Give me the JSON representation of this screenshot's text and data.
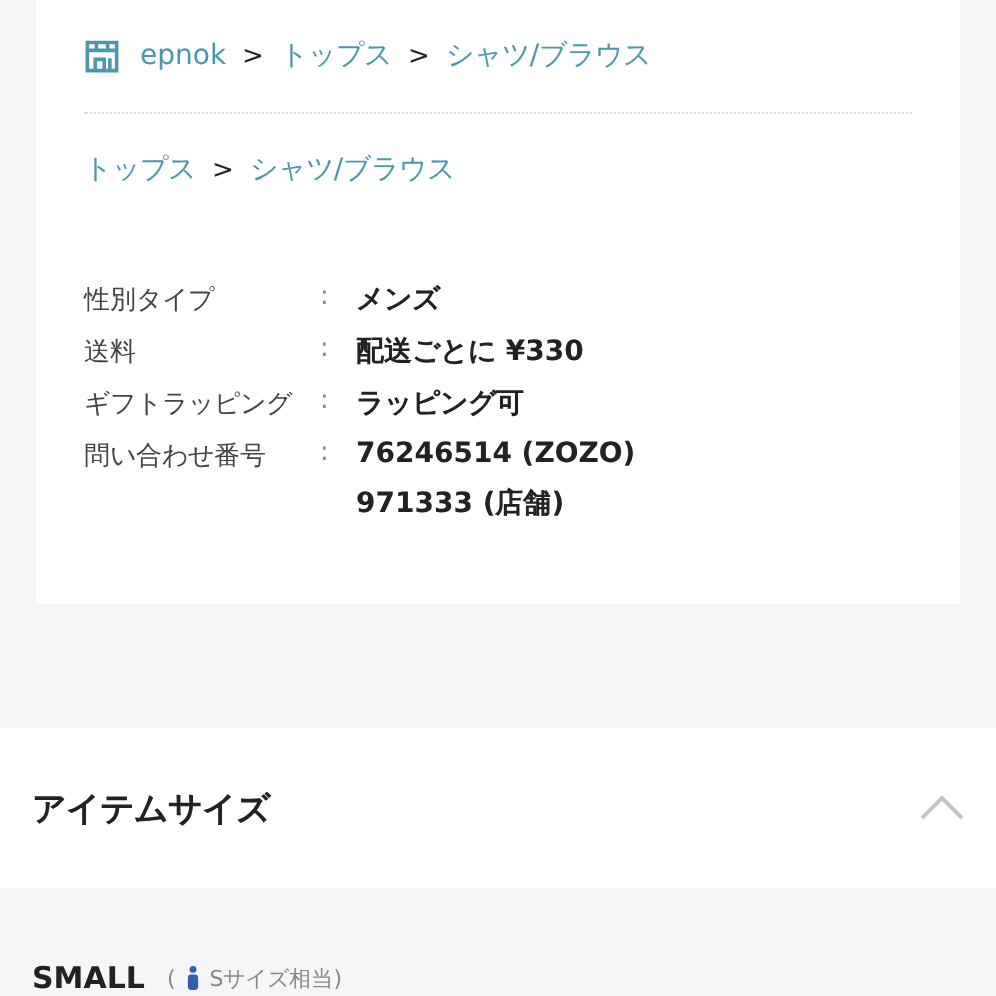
{
  "breadcrumbs": [
    {
      "kind": "shop",
      "items": [
        "epnok",
        "トップス",
        "シャツ/ブラウス"
      ],
      "separator": ">"
    },
    {
      "kind": "category",
      "items": [
        "トップス",
        "シャツ/ブラウス"
      ],
      "separator": ">"
    }
  ],
  "details": [
    {
      "label": "性別タイプ",
      "values": [
        "メンズ"
      ]
    },
    {
      "label": "送料",
      "values": [
        "配送ごとに ¥330"
      ]
    },
    {
      "label": "ギフトラッピング",
      "values": [
        "ラッピング可"
      ]
    },
    {
      "label": "問い合わせ番号",
      "values": [
        "76246514 (ZOZO)",
        "971333 (店舗)"
      ]
    }
  ],
  "separator": ":",
  "size_section": {
    "title": "アイテムサイズ",
    "expanded": true
  },
  "size": {
    "name": "SMALL",
    "open": "(",
    "note": "Sサイズ相当)"
  }
}
